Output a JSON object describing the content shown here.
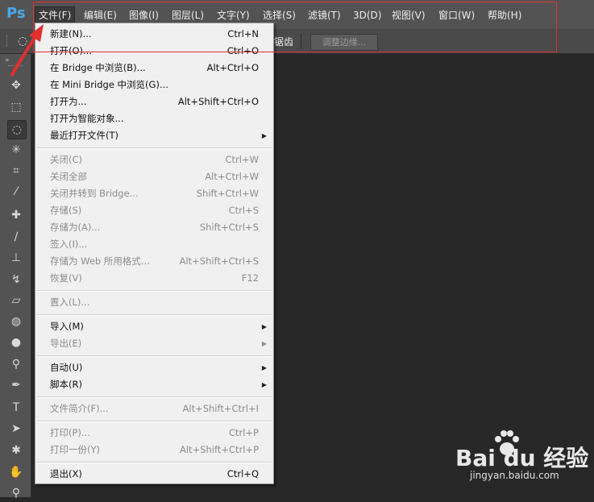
{
  "app": {
    "logo": "Ps"
  },
  "menubar": {
    "items": [
      {
        "label": "文件(F)"
      },
      {
        "label": "编辑(E)"
      },
      {
        "label": "图像(I)"
      },
      {
        "label": "图层(L)"
      },
      {
        "label": "文字(Y)"
      },
      {
        "label": "选择(S)"
      },
      {
        "label": "滤镜(T)"
      },
      {
        "label": "3D(D)"
      },
      {
        "label": "视图(V)"
      },
      {
        "label": "窗口(W)"
      },
      {
        "label": "帮助(H)"
      }
    ],
    "active_index": 0
  },
  "options_bar": {
    "partial_text": "锯齿",
    "refine_edge_label": "调整边缘..."
  },
  "tools": {
    "panel_header": "»",
    "items": [
      {
        "icon": "move-icon",
        "glyph": "✥"
      },
      {
        "icon": "rectangular-marquee-icon",
        "glyph": "⬚"
      },
      {
        "icon": "lasso-icon",
        "glyph": "◌"
      },
      {
        "icon": "magic-wand-icon",
        "glyph": "✳"
      },
      {
        "icon": "crop-icon",
        "glyph": "⌗"
      },
      {
        "icon": "eyedropper-icon",
        "glyph": "⁄"
      },
      {
        "icon": "healing-brush-icon",
        "glyph": "✚"
      },
      {
        "icon": "brush-icon",
        "glyph": "∕"
      },
      {
        "icon": "clone-stamp-icon",
        "glyph": "⊥"
      },
      {
        "icon": "history-brush-icon",
        "glyph": "↯"
      },
      {
        "icon": "eraser-icon",
        "glyph": "▱"
      },
      {
        "icon": "paint-bucket-icon",
        "glyph": "◍"
      },
      {
        "icon": "blur-icon",
        "glyph": "●"
      },
      {
        "icon": "dodge-icon",
        "glyph": "⚲"
      },
      {
        "icon": "pen-icon",
        "glyph": "✒"
      },
      {
        "icon": "type-icon",
        "glyph": "T"
      },
      {
        "icon": "path-selection-icon",
        "glyph": "➤"
      },
      {
        "icon": "custom-shape-icon",
        "glyph": "✱"
      },
      {
        "icon": "hand-icon",
        "glyph": "✋"
      },
      {
        "icon": "zoom-icon",
        "glyph": "⚲"
      }
    ]
  },
  "file_menu": {
    "items": [
      {
        "label": "新建(N)...",
        "shortcut": "Ctrl+N",
        "disabled": false,
        "submenu": false
      },
      {
        "label": "打开(O)...",
        "shortcut": "Ctrl+O",
        "disabled": false,
        "submenu": false
      },
      {
        "label": "在 Bridge 中浏览(B)...",
        "shortcut": "Alt+Ctrl+O",
        "disabled": false,
        "submenu": false
      },
      {
        "label": "在 Mini Bridge 中浏览(G)...",
        "shortcut": "",
        "disabled": false,
        "submenu": false
      },
      {
        "label": "打开为...",
        "shortcut": "Alt+Shift+Ctrl+O",
        "disabled": false,
        "submenu": false
      },
      {
        "label": "打开为智能对象...",
        "shortcut": "",
        "disabled": false,
        "submenu": false
      },
      {
        "label": "最近打开文件(T)",
        "shortcut": "",
        "disabled": false,
        "submenu": true
      },
      {
        "separator": true
      },
      {
        "label": "关闭(C)",
        "shortcut": "Ctrl+W",
        "disabled": true,
        "submenu": false
      },
      {
        "label": "关闭全部",
        "shortcut": "Alt+Ctrl+W",
        "disabled": true,
        "submenu": false
      },
      {
        "label": "关闭并转到 Bridge...",
        "shortcut": "Shift+Ctrl+W",
        "disabled": true,
        "submenu": false
      },
      {
        "label": "存储(S)",
        "shortcut": "Ctrl+S",
        "disabled": true,
        "submenu": false
      },
      {
        "label": "存储为(A)...",
        "shortcut": "Shift+Ctrl+S",
        "disabled": true,
        "submenu": false
      },
      {
        "label": "签入(I)...",
        "shortcut": "",
        "disabled": true,
        "submenu": false
      },
      {
        "label": "存储为 Web 所用格式...",
        "shortcut": "Alt+Shift+Ctrl+S",
        "disabled": true,
        "submenu": false
      },
      {
        "label": "恢复(V)",
        "shortcut": "F12",
        "disabled": true,
        "submenu": false
      },
      {
        "separator": true
      },
      {
        "label": "置入(L)...",
        "shortcut": "",
        "disabled": true,
        "submenu": false
      },
      {
        "separator": true
      },
      {
        "label": "导入(M)",
        "shortcut": "",
        "disabled": false,
        "submenu": true
      },
      {
        "label": "导出(E)",
        "shortcut": "",
        "disabled": true,
        "submenu": true
      },
      {
        "separator": true
      },
      {
        "label": "自动(U)",
        "shortcut": "",
        "disabled": false,
        "submenu": true
      },
      {
        "label": "脚本(R)",
        "shortcut": "",
        "disabled": false,
        "submenu": true
      },
      {
        "separator": true
      },
      {
        "label": "文件简介(F)...",
        "shortcut": "Alt+Shift+Ctrl+I",
        "disabled": true,
        "submenu": false
      },
      {
        "separator": true
      },
      {
        "label": "打印(P)...",
        "shortcut": "Ctrl+P",
        "disabled": true,
        "submenu": false
      },
      {
        "label": "打印一份(Y)",
        "shortcut": "Alt+Shift+Ctrl+P",
        "disabled": true,
        "submenu": false
      },
      {
        "separator": true
      },
      {
        "label": "退出(X)",
        "shortcut": "Ctrl+Q",
        "disabled": false,
        "submenu": false
      }
    ]
  },
  "watermark": {
    "main": "Bai du 经验",
    "sub": "jingyan.baidu.com"
  },
  "colors": {
    "annotation_red": "#e03030",
    "menubar_bg": "#535353",
    "canvas_bg": "#282828",
    "menu_bg": "#f0f0f0"
  }
}
